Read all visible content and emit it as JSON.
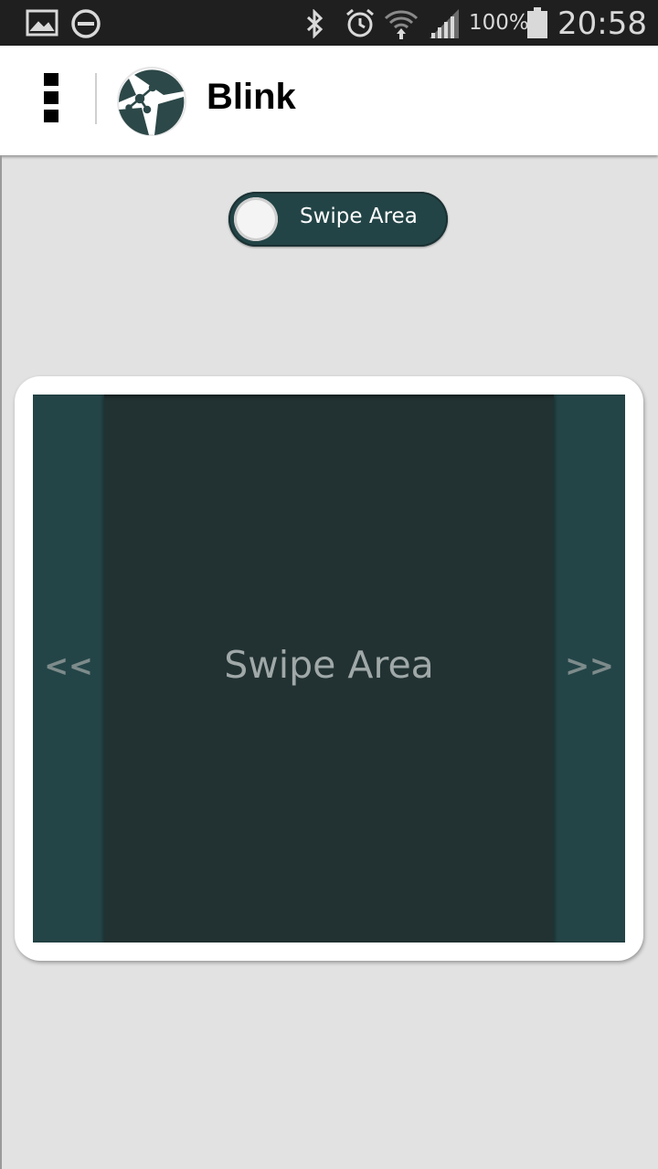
{
  "status_bar": {
    "battery_percent": "100%",
    "time": "20:58",
    "icons": [
      "image-icon",
      "do-not-disturb-icon",
      "bluetooth-icon",
      "alarm-icon",
      "wifi-icon",
      "signal-icon",
      "battery-icon"
    ]
  },
  "app_bar": {
    "title": "Blink",
    "menu_icon": "menu-icon",
    "logo_icon": "blink-logo-icon"
  },
  "toggle": {
    "label": "Swipe Area",
    "state": "off"
  },
  "swipe_area": {
    "label": "Swipe Area",
    "left_arrow": "<<",
    "right_arrow": ">>"
  },
  "colors": {
    "status_bar_bg": "#1f1f1f",
    "page_bg": "#e2e2e2",
    "accent_dark_teal": "#234446",
    "swipe_center_bg": "#223232",
    "swipe_side_bg": "#244548"
  }
}
